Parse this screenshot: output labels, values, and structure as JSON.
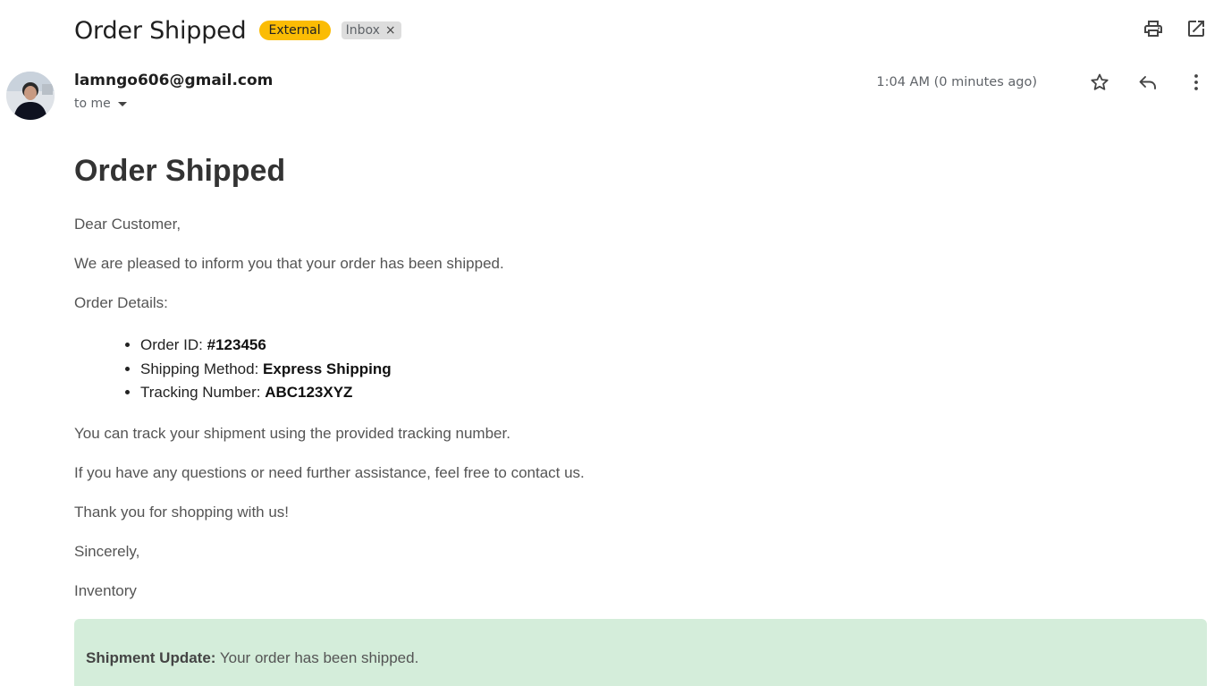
{
  "email": {
    "subject": "Order Shipped",
    "labels": {
      "external": "External",
      "inbox": "Inbox",
      "remove": "×"
    },
    "sender": "lamngo606@gmail.com",
    "recipient_summary": "to me",
    "timestamp": "1:04 AM (0 minutes ago)"
  },
  "icons": {
    "print": "print-icon",
    "open_new_window": "open-in-new-window-icon",
    "star": "star-icon",
    "reply": "reply-icon",
    "more": "more-vertical-icon",
    "caret": "caret-down-icon"
  },
  "body": {
    "heading": "Order Shipped",
    "greeting": "Dear Customer,",
    "intro": "We are pleased to inform you that your order has been shipped.",
    "details_label": "Order Details:",
    "details": [
      {
        "label": "Order ID: ",
        "value": "#123456"
      },
      {
        "label": "Shipping Method: ",
        "value": "Express Shipping"
      },
      {
        "label": "Tracking Number: ",
        "value": "ABC123XYZ"
      }
    ],
    "track_note": "You can track your shipment using the provided tracking number.",
    "questions_note": "If you have any questions or need further assistance, feel free to contact us.",
    "thanks": "Thank you for shopping with us!",
    "signoff": "Sincerely,",
    "signature": "Inventory",
    "notice_label": "Shipment Update:",
    "notice_text": " Your order has been shipped."
  },
  "colors": {
    "external_badge": "#fbbc04",
    "inbox_badge": "#dddddd",
    "notice_bg": "#d4edda"
  }
}
